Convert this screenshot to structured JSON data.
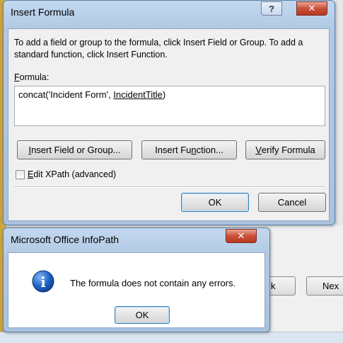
{
  "insert_formula": {
    "title": "Insert Formula",
    "help_glyph": "?",
    "close_glyph": "✕",
    "instructions": "To add a field or group to the formula, click Insert Field or Group. To add a standard function, click Insert Function.",
    "formula_label_u": "F",
    "formula_label_rest": "ormula:",
    "formula": {
      "prefix": "concat('Incident Form', ",
      "field": "IncidentTitle",
      "suffix": ")"
    },
    "buttons": {
      "insert_field_u": "I",
      "insert_field_rest": "nsert Field or Group...",
      "insert_function_pre": "Insert Fu",
      "insert_function_u": "n",
      "insert_function_post": "ction...",
      "verify_pre": "",
      "verify_u": "V",
      "verify_post": "erify Formula",
      "ok": "OK",
      "cancel": "Cancel"
    },
    "edit_xpath_pre": "",
    "edit_xpath_u": "E",
    "edit_xpath_post": "dit XPath (advanced)",
    "edit_xpath_checked": false
  },
  "infopath_dialog": {
    "title": "Microsoft Office InfoPath",
    "close_glyph": "✕",
    "message": "The formula does not contain any errors.",
    "icon": "info-icon",
    "icon_glyph": "i",
    "ok": "OK"
  },
  "background": {
    "back_button_partial": "k",
    "next_button_partial": "Nex"
  }
}
